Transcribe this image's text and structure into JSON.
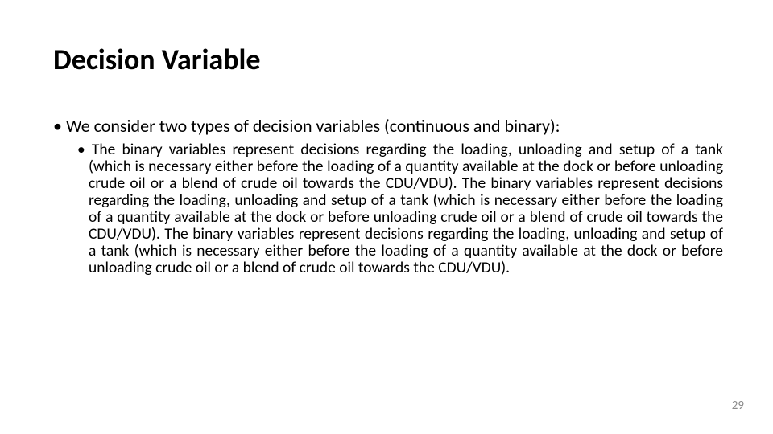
{
  "slide": {
    "title": "Decision Variable",
    "bullet1": "We consider two types of decision variables (continuous and binary):",
    "bullet2": "The binary variables represent decisions regarding the loading, unloading and setup of a tank (which is necessary either before the loading of a quantity available at the dock or before unloading crude oil or a blend of crude oil towards the CDU/VDU). The binary variables represent decisions regarding the loading, unloading and setup of a tank (which is necessary either before the loading of a quantity available at the dock or before unloading crude oil or a blend of crude oil towards the CDU/VDU). The binary variables represent decisions regarding the loading, unloading and setup of a tank (which is necessary either before the loading of a quantity available at the dock or before unloading crude oil or a blend of crude oil towards the CDU/VDU).",
    "page_number": "29"
  }
}
